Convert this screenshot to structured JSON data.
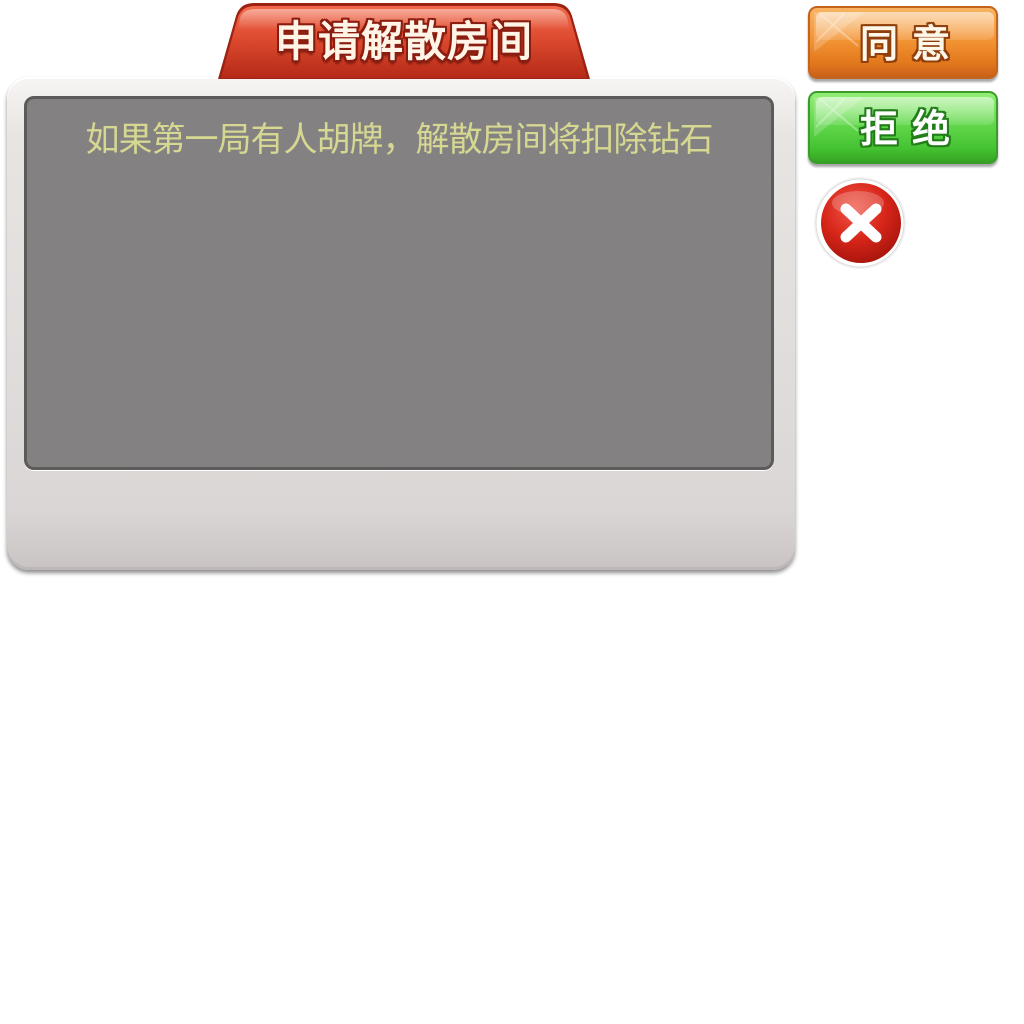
{
  "dialog": {
    "title": "申请解散房间",
    "message": "如果第一局有人胡牌，解散房间将扣除钻石"
  },
  "actions": {
    "agree_label": "同意",
    "reject_label": "拒绝",
    "close_icon": "close-x-icon"
  },
  "colors": {
    "title_red": "#d9432b",
    "panel_bg": "#e0dcdb",
    "content_bg": "#838182",
    "message_text": "#d6d791",
    "agree_orange": "#f39536",
    "reject_green": "#62d84c",
    "close_red": "#d8261a"
  }
}
